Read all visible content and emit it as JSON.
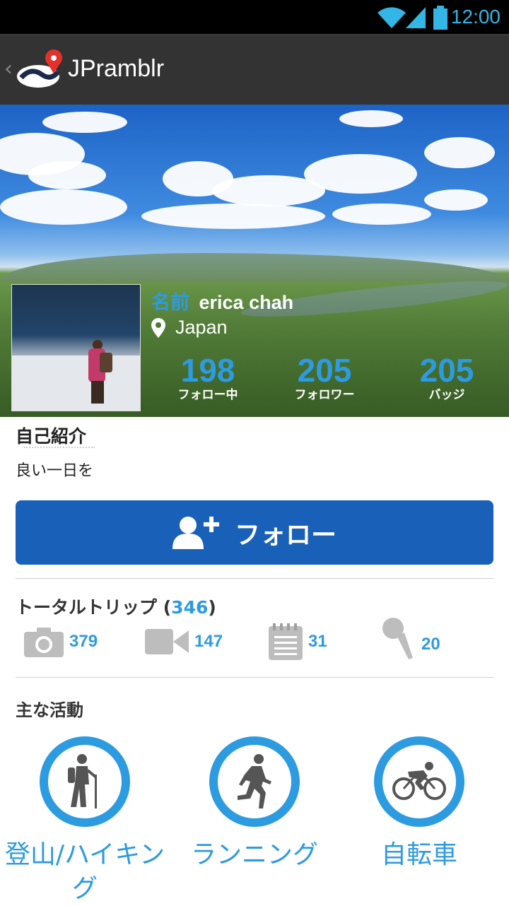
{
  "status_bar": {
    "time": "12:00",
    "wifi_icon": "wifi-icon",
    "signal_icon": "signal-icon",
    "battery_icon": "battery-icon"
  },
  "action_bar": {
    "back_glyph": "‹",
    "logo_icon": "jpramblr-logo-icon",
    "title": "JPramblr"
  },
  "profile": {
    "name_label": "名前",
    "name": "erica chah",
    "location_icon": "map-pin-icon",
    "location": "Japan",
    "stats": [
      {
        "value": "198",
        "label": "フォロー中"
      },
      {
        "value": "205",
        "label": "フォロワー"
      },
      {
        "value": "205",
        "label": "バッジ"
      }
    ]
  },
  "bio": {
    "heading": "自己紹介",
    "text": "良い一日を"
  },
  "follow_button": {
    "icon": "add-user-icon",
    "label": "フォロー"
  },
  "trips": {
    "heading": "トータルトリップ",
    "open_paren": "(",
    "total": "346",
    "close_paren": ")",
    "items": [
      {
        "icon": "camera-icon",
        "value": "379"
      },
      {
        "icon": "video-camera-icon",
        "value": "147"
      },
      {
        "icon": "notepad-icon",
        "value": "31"
      },
      {
        "icon": "microphone-icon",
        "value": "20"
      }
    ]
  },
  "activities": {
    "heading": "主な活動",
    "items": [
      {
        "icon": "hiking-icon",
        "label": "登山/ハイキング"
      },
      {
        "icon": "running-icon",
        "label": "ランニング"
      },
      {
        "icon": "cycling-icon",
        "label": "自転車"
      }
    ]
  },
  "colors": {
    "accent": "#2d9be0",
    "button": "#1961b8",
    "action_bar": "#333333"
  }
}
